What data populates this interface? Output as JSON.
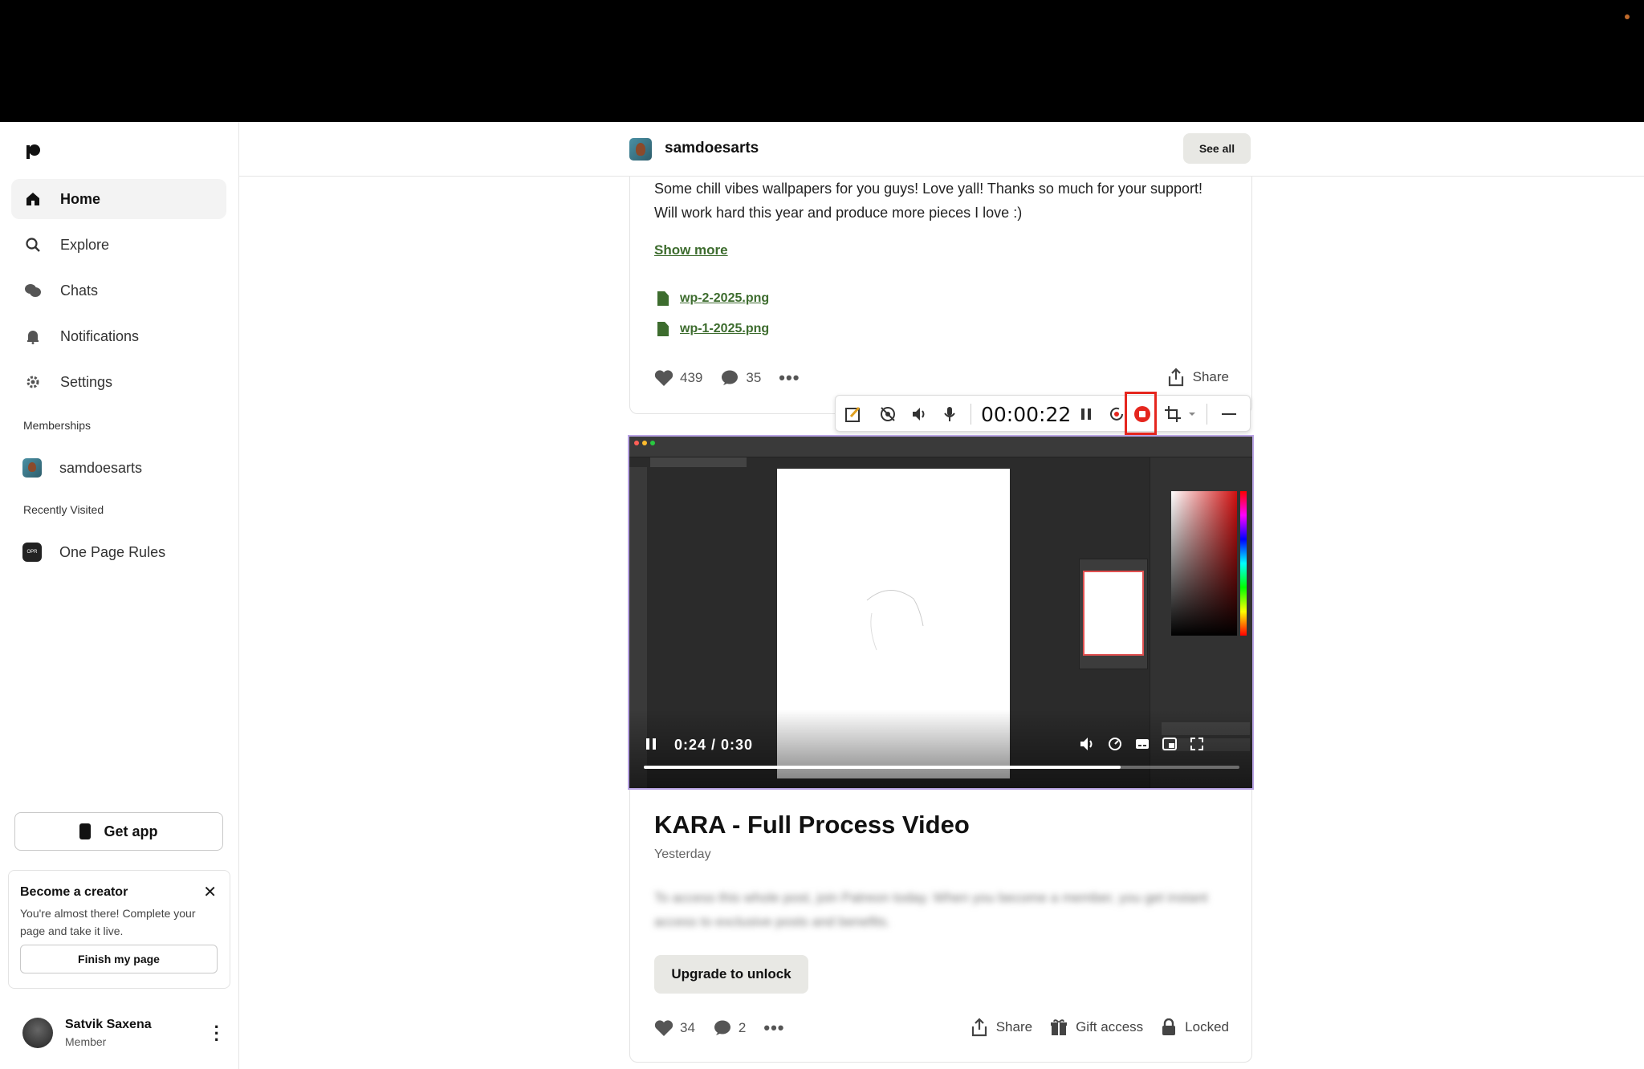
{
  "sidebar": {
    "nav": [
      {
        "label": "Home",
        "icon": "home-icon"
      },
      {
        "label": "Explore",
        "icon": "search-icon"
      },
      {
        "label": "Chats",
        "icon": "chat-icon"
      },
      {
        "label": "Notifications",
        "icon": "bell-icon"
      },
      {
        "label": "Settings",
        "icon": "gear-icon"
      }
    ],
    "memberships_label": "Memberships",
    "membership": "samdoesarts",
    "recent_label": "Recently Visited",
    "recent": "One Page Rules",
    "get_app": "Get app",
    "creator_card": {
      "title": "Become a creator",
      "desc": "You're almost there! Complete your page and take it live.",
      "button": "Finish my page"
    },
    "user": {
      "name": "Satvik Saxena",
      "role": "Member"
    }
  },
  "header": {
    "creator": "samdoesarts",
    "see_all": "See all"
  },
  "post1": {
    "body": "Some chill vibes wallpapers for you guys! Love yall! Thanks so much for your support! Will work hard this year and produce more pieces I love :)",
    "show_more": "Show more",
    "files": [
      "wp-2-2025.png",
      "wp-1-2025.png"
    ],
    "likes": "439",
    "comments": "35",
    "share": "Share"
  },
  "recorder": {
    "timer": "00:00:22"
  },
  "video": {
    "time": "0:24 / 0:30",
    "progress": 0.8
  },
  "post2": {
    "title": "KARA - Full Process Video",
    "date": "Yesterday",
    "blurred_text": "To access this whole post, join Patreon today. When you become a member, you get instant access to exclusive posts and benefits.",
    "upgrade": "Upgrade to unlock",
    "likes": "34",
    "comments": "2",
    "share": "Share",
    "gift": "Gift access",
    "locked": "Locked"
  },
  "colors": {
    "accent_green": "#3d6c2e",
    "record_red": "#e5261e",
    "video_border": "#b9a4e4"
  }
}
